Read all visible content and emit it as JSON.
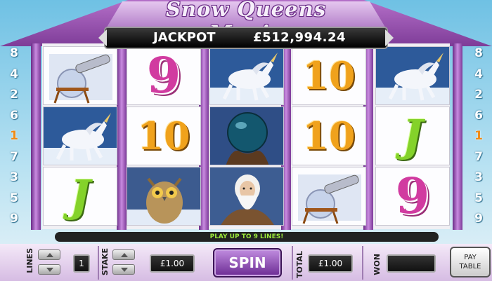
{
  "title": "Snow Queens Magic",
  "jackpot": {
    "label": "JACKPOT",
    "value": "£512,994.24"
  },
  "paylines_left": [
    "8",
    "4",
    "2",
    "6",
    "1",
    "7",
    "3",
    "5",
    "9"
  ],
  "paylines_right": [
    "8",
    "4",
    "2",
    "6",
    "1",
    "7",
    "3",
    "5",
    "9"
  ],
  "reels": [
    [
      "telescope-orb",
      "unicorn",
      "J"
    ],
    [
      "9",
      "10",
      "owl"
    ],
    [
      "unicorn",
      "crystal-ball",
      "wizard"
    ],
    [
      "10",
      "10",
      "telescope-orb"
    ],
    [
      "unicorn",
      "J",
      "9"
    ]
  ],
  "message": "PLAY UP TO 9 LINES!",
  "controls": {
    "lines_label": "LINES",
    "lines_value": "1",
    "stake_label": "STAKE",
    "stake_value": "£1.00",
    "spin_label": "SPIN",
    "total_label": "TOTAL",
    "total_value": "£1.00",
    "won_label": "WON",
    "won_value": "",
    "paytable_line1": "PAY",
    "paytable_line2": "TABLE"
  },
  "colors": {
    "frame_purple": "#8a3fa8",
    "highlight_orange": "#f08b15",
    "message_green": "#9be83a"
  }
}
